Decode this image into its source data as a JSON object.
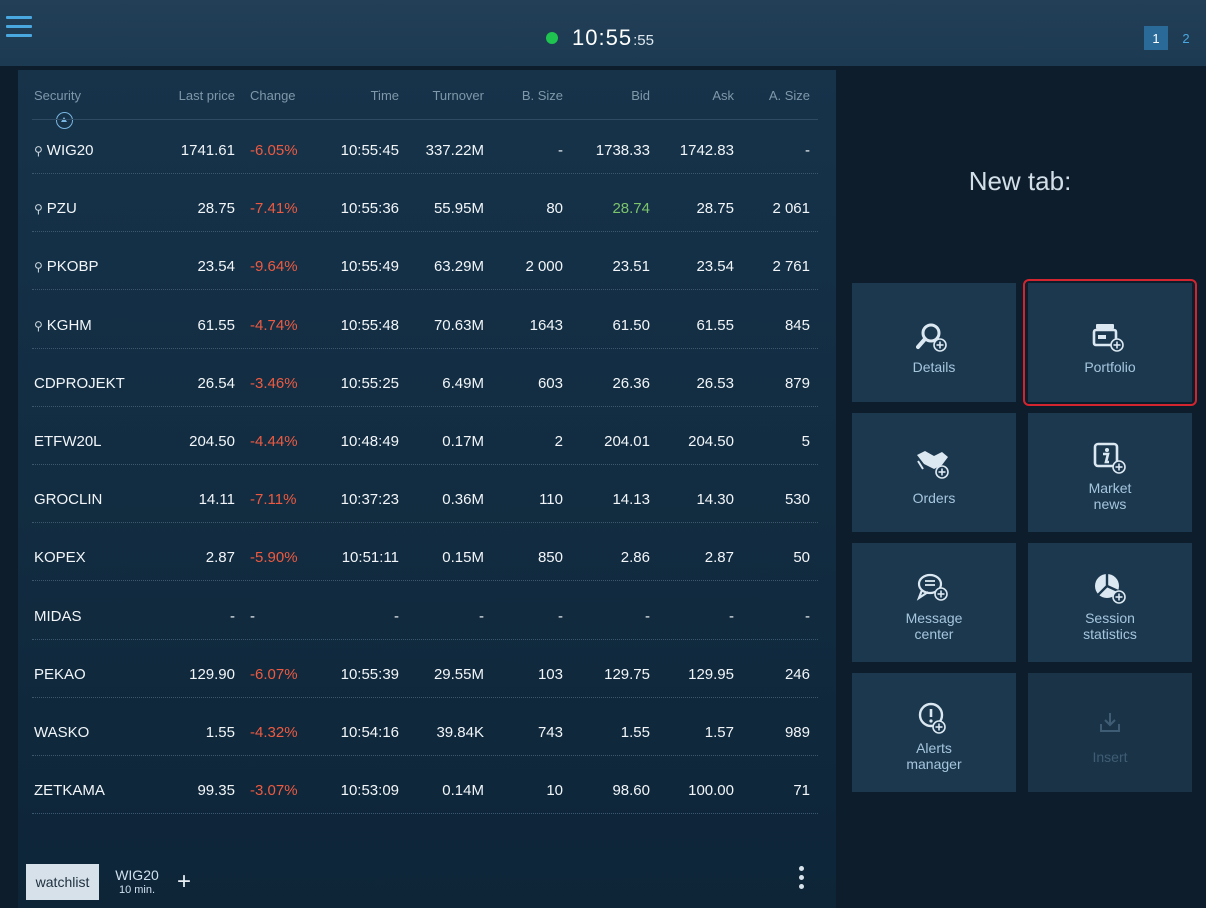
{
  "topbar": {
    "clock_main": "10:55",
    "clock_seconds": ":55",
    "status_color": "#1fc34f",
    "tabs": [
      {
        "label": "1",
        "active": true
      },
      {
        "label": "2",
        "active": false
      }
    ],
    "menu_icon": "hamburger-menu-icon"
  },
  "table": {
    "headers": [
      "Security",
      "Last price",
      "Change",
      "Time",
      "Turnover",
      "B. Size",
      "Bid",
      "Ask",
      "A. Size"
    ],
    "sort_column": "Security",
    "rows": [
      {
        "security": "WIG20",
        "pinned": true,
        "last": "1741.61",
        "change": "-6.05%",
        "time": "10:55:45",
        "turnover": "337.22M",
        "bsize": "-",
        "bid": "1738.33",
        "ask": "1742.83",
        "asize": "-",
        "bid_color": ""
      },
      {
        "security": "PZU",
        "pinned": true,
        "last": "28.75",
        "change": "-7.41%",
        "time": "10:55:36",
        "turnover": "55.95M",
        "bsize": "80",
        "bid": "28.74",
        "ask": "28.75",
        "asize": "2 061",
        "bid_color": "up"
      },
      {
        "security": "PKOBP",
        "pinned": true,
        "last": "23.54",
        "change": "-9.64%",
        "time": "10:55:49",
        "turnover": "63.29M",
        "bsize": "2 000",
        "bid": "23.51",
        "ask": "23.54",
        "asize": "2 761",
        "bid_color": ""
      },
      {
        "security": "KGHM",
        "pinned": true,
        "last": "61.55",
        "change": "-4.74%",
        "time": "10:55:48",
        "turnover": "70.63M",
        "bsize": "1643",
        "bid": "61.50",
        "ask": "61.55",
        "asize": "845",
        "bid_color": ""
      },
      {
        "security": "CDPROJEKT",
        "pinned": false,
        "last": "26.54",
        "change": "-3.46%",
        "time": "10:55:25",
        "turnover": "6.49M",
        "bsize": "603",
        "bid": "26.36",
        "ask": "26.53",
        "asize": "879",
        "bid_color": ""
      },
      {
        "security": "ETFW20L",
        "pinned": false,
        "last": "204.50",
        "change": "-4.44%",
        "time": "10:48:49",
        "turnover": "0.17M",
        "bsize": "2",
        "bid": "204.01",
        "ask": "204.50",
        "asize": "5",
        "bid_color": ""
      },
      {
        "security": "GROCLIN",
        "pinned": false,
        "last": "14.11",
        "change": "-7.11%",
        "time": "10:37:23",
        "turnover": "0.36M",
        "bsize": "110",
        "bid": "14.13",
        "ask": "14.30",
        "asize": "530",
        "bid_color": ""
      },
      {
        "security": "KOPEX",
        "pinned": false,
        "last": "2.87",
        "change": "-5.90%",
        "time": "10:51:11",
        "turnover": "0.15M",
        "bsize": "850",
        "bid": "2.86",
        "ask": "2.87",
        "asize": "50",
        "bid_color": ""
      },
      {
        "security": "MIDAS",
        "pinned": false,
        "last": "-",
        "change": "-",
        "time": "-",
        "turnover": "-",
        "bsize": "-",
        "bid": "-",
        "ask": "-",
        "asize": "-",
        "bid_color": ""
      },
      {
        "security": "PEKAO",
        "pinned": false,
        "last": "129.90",
        "change": "-6.07%",
        "time": "10:55:39",
        "turnover": "29.55M",
        "bsize": "103",
        "bid": "129.75",
        "ask": "129.95",
        "asize": "246",
        "bid_color": ""
      },
      {
        "security": "WASKO",
        "pinned": false,
        "last": "1.55",
        "change": "-4.32%",
        "time": "10:54:16",
        "turnover": "39.84K",
        "bsize": "743",
        "bid": "1.55",
        "ask": "1.57",
        "asize": "989",
        "bid_color": ""
      },
      {
        "security": "ZETKAMA",
        "pinned": false,
        "last": "99.35",
        "change": "-3.07%",
        "time": "10:53:09",
        "turnover": "0.14M",
        "bsize": "10",
        "bid": "98.60",
        "ask": "100.00",
        "asize": "71",
        "bid_color": ""
      }
    ]
  },
  "bottom_tabs": {
    "watchlist": "watchlist",
    "wig20_title": "WIG20",
    "wig20_sub": "10 min.",
    "add": "+"
  },
  "new_tab": {
    "title": "New tab:",
    "tiles": [
      {
        "id": "details",
        "label": "Details",
        "icon": "search-add-icon"
      },
      {
        "id": "portfolio",
        "label": "Portfolio",
        "icon": "wallet-add-icon"
      },
      {
        "id": "orders",
        "label": "Orders",
        "icon": "handshake-add-icon"
      },
      {
        "id": "market-news",
        "label": "Market news",
        "icon": "info-add-icon"
      },
      {
        "id": "message-center",
        "label": "Message center",
        "icon": "chat-add-icon"
      },
      {
        "id": "session-statistics",
        "label": "Session statistics",
        "icon": "pie-chart-add-icon"
      },
      {
        "id": "alerts-manager",
        "label": "Alerts manager",
        "icon": "alert-add-icon"
      },
      {
        "id": "insert",
        "label": "Insert",
        "icon": "download-icon"
      }
    ]
  },
  "colors": {
    "negative": "#ee5a41",
    "positive": "#7cc46c",
    "accent": "#4aa8e0",
    "highlight": "#d3252f"
  }
}
